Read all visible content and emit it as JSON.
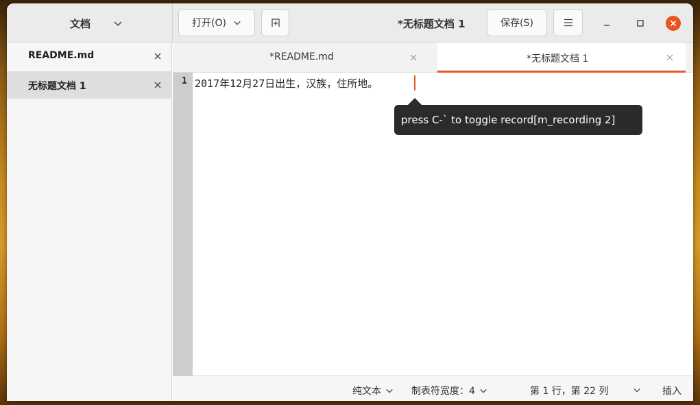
{
  "sidebar": {
    "title": "文档",
    "items": [
      {
        "label": "README.md"
      },
      {
        "label": "无标题文档 1"
      }
    ]
  },
  "header": {
    "open_label": "打开(O)",
    "window_title": "*无标题文档 1",
    "save_label": "保存(S)"
  },
  "tabs": [
    {
      "label": "*README.md"
    },
    {
      "label": "*无标题文档 1"
    }
  ],
  "editor": {
    "line_number": "1",
    "line_text": "2017年12月27日出生，汉族，住所地。"
  },
  "tooltip": "press C-` to toggle record[m_recording 2]",
  "status": {
    "mode": "纯文本",
    "tab_width": "制表符宽度：4",
    "position": "第 1 行，第 22 列",
    "insert": "插入"
  },
  "colors": {
    "accent": "#e95420"
  }
}
